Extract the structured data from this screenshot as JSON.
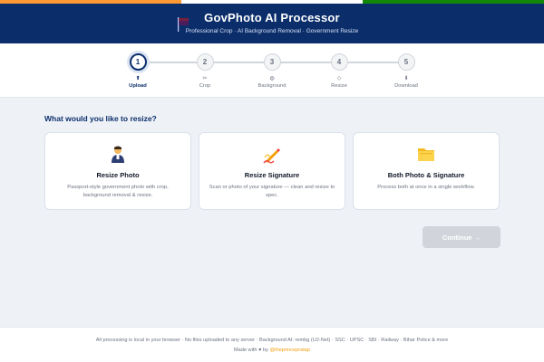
{
  "header": {
    "title": "GovPhoto AI Processor",
    "subtitle": "Professional Crop · AI Background Removal · Government Resize"
  },
  "stepper": {
    "steps": [
      {
        "number": "1",
        "icon": "upload-icon",
        "icon_glyph": "⬆",
        "label": "Upload",
        "active": true
      },
      {
        "number": "2",
        "icon": "scissors-icon",
        "icon_glyph": "✂",
        "label": "Crop",
        "active": false
      },
      {
        "number": "3",
        "icon": "palette-icon",
        "icon_glyph": "◍",
        "label": "Background",
        "active": false
      },
      {
        "number": "4",
        "icon": "resize-icon",
        "icon_glyph": "◇",
        "label": "Resize",
        "active": false
      },
      {
        "number": "5",
        "icon": "download-icon",
        "icon_glyph": "⬇",
        "label": "Download",
        "active": false
      }
    ]
  },
  "main": {
    "question": "What would you like to resize?",
    "cards": [
      {
        "icon": "person-icon",
        "title": "Resize Photo",
        "description": "Passport-style government photo with crop, background removal & resize."
      },
      {
        "icon": "signature-icon",
        "title": "Resize Signature",
        "description": "Scan or photo of your signature — clean and resize to spec."
      },
      {
        "icon": "folder-icon",
        "title": "Both Photo & Signature",
        "description": "Process both at once in a single workflow."
      }
    ],
    "continue_label": "Continue →"
  },
  "footer": {
    "note": "All processing is local in your browser · No files uploaded to any server · Background AI: rembg (U2-Net) · SSC · UPSC · SBI · Railway · Bihar Police & more",
    "made_prefix": "Made with",
    "heart": "♥",
    "made_by": "by",
    "handle": "@theprincepratap"
  },
  "colors": {
    "primary": "#0b2e6b",
    "saffron": "#ff9933",
    "green": "#138808",
    "disabled": "#d1d5db",
    "accent": "#f59e0b"
  }
}
